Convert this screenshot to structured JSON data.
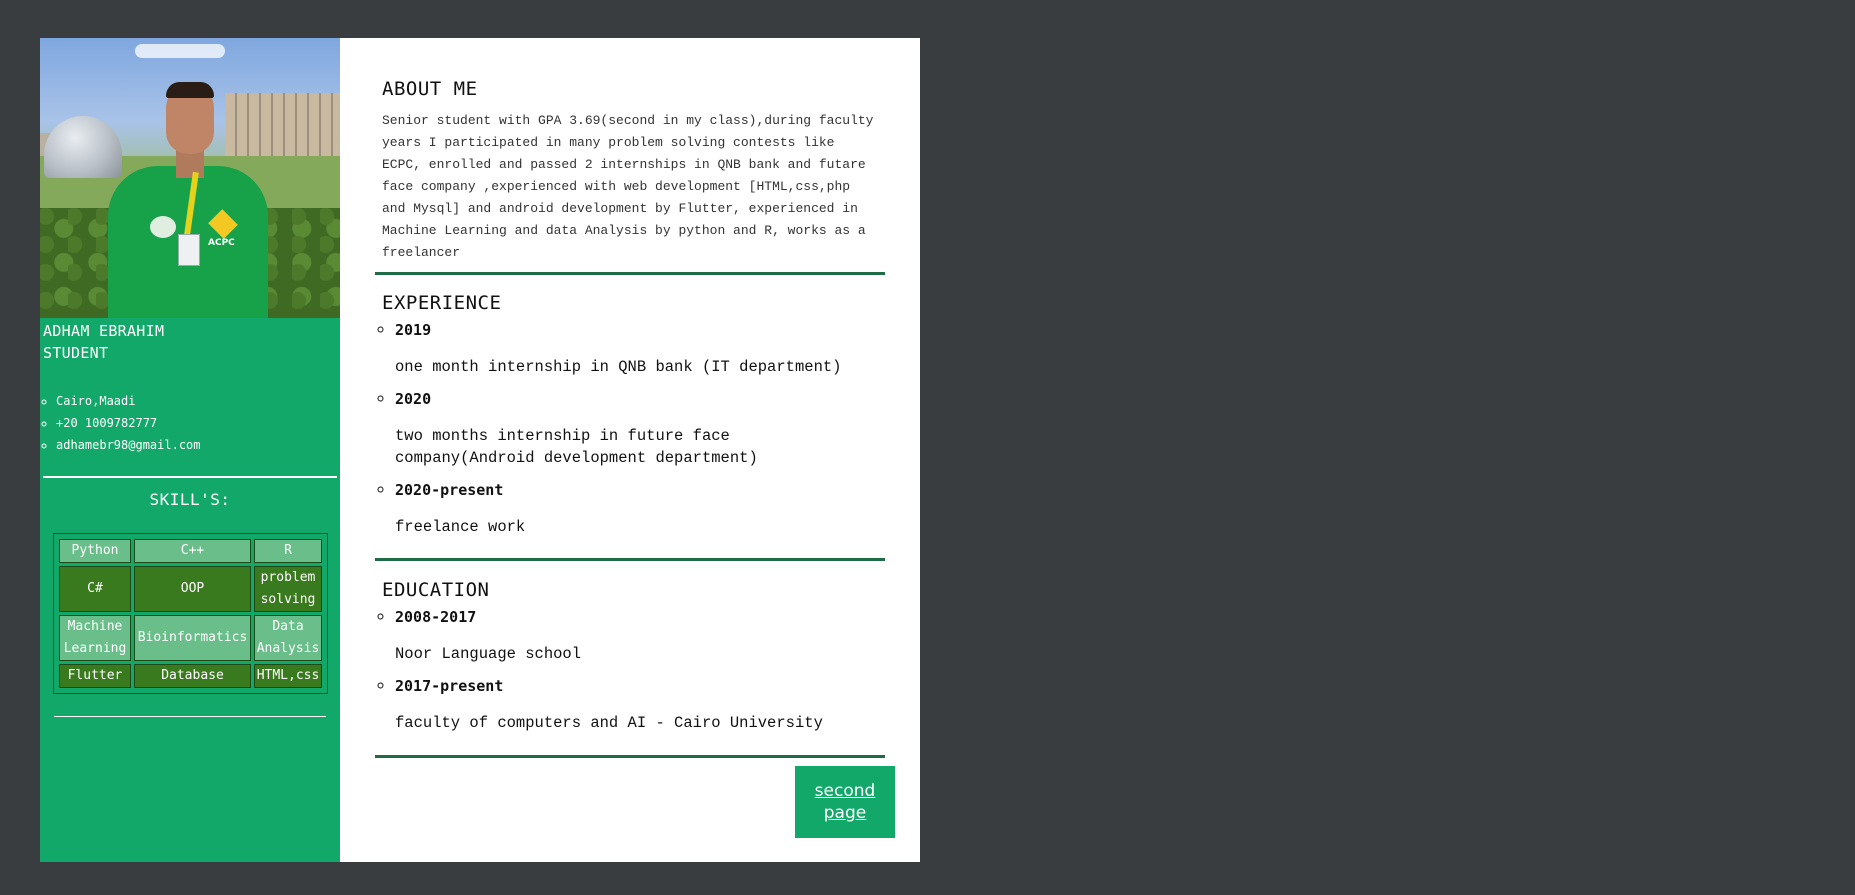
{
  "profile": {
    "name": "ADHAM EBRAHIM",
    "title": "STUDENT",
    "contacts": [
      "Cairo,Maadi",
      "+20 1009782777",
      "adhamebr98@gmail.com"
    ]
  },
  "photo": {
    "shirt_logo_text": "ACPC"
  },
  "skills": {
    "heading": "SKILL'S:",
    "rows": [
      [
        "Python",
        "C++",
        "R"
      ],
      [
        "C#",
        "OOP",
        "problem solving"
      ],
      [
        "Machine Learning",
        "Bioinformatics",
        "Data Analysis"
      ],
      [
        "Flutter",
        "Database",
        "HTML,css"
      ]
    ]
  },
  "about": {
    "title": "ABOUT ME",
    "text": "Senior student with GPA 3.69(second in my class),during faculty years I participated in many problem solving contests like ECPC, enrolled and passed 2 internships in QNB bank and futare face company ,experienced with web development [HTML,css,php and Mysql] and android development by Flutter, experienced in Machine Learning and data Analysis by python and R, works as a freelancer"
  },
  "experience": {
    "title": "EXPERIENCE",
    "items": [
      {
        "year": "2019",
        "desc": "one month internship in QNB bank (IT department)"
      },
      {
        "year": "2020",
        "desc": "two months internship in future face company(Android development department)"
      },
      {
        "year": "2020-present",
        "desc": "freelance work"
      }
    ]
  },
  "education": {
    "title": "EDUCATION",
    "items": [
      {
        "year": "2008-2017",
        "desc": "Noor Language school"
      },
      {
        "year": "2017-present",
        "desc": "faculty of computers and AI - Cairo University"
      }
    ]
  },
  "navigation": {
    "second_page_label": "second page"
  },
  "colors": {
    "background": "#3a3d40",
    "sidebar": "#12a86a",
    "skill_light": "#6abe8a",
    "skill_dark": "#3a7a1e",
    "divider": "#1e6b45"
  }
}
